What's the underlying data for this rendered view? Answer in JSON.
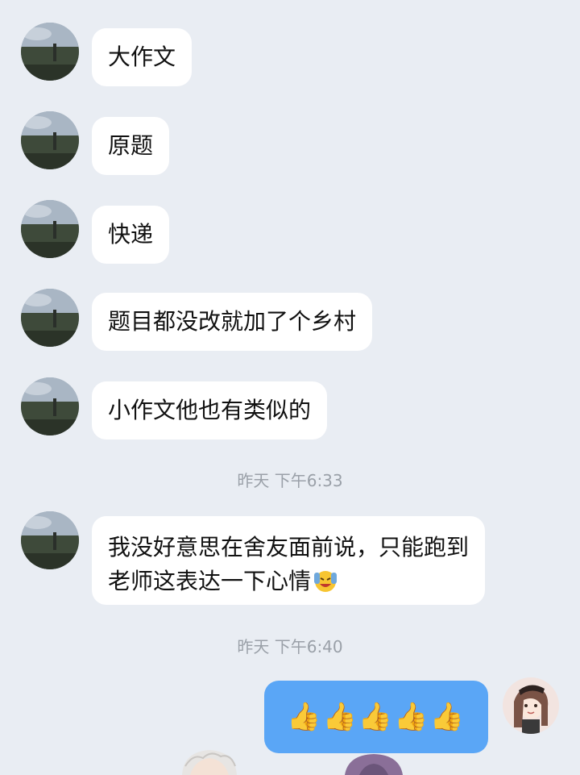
{
  "messages": [
    {
      "text": "大作文"
    },
    {
      "text": "原题"
    },
    {
      "text": "快递"
    },
    {
      "text": "题目都没改就加了个乡村"
    },
    {
      "text": "小作文他也有类似的"
    },
    {
      "text": "我没好意思在舍友面前说，只能跑到老师这表达一下心情"
    }
  ],
  "timestamps": [
    "昨天 下午6:33",
    "昨天 下午6:40"
  ],
  "my_message": {
    "text": "👍👍👍👍👍"
  },
  "emoji_icon": "facepalm-laugh-emoji",
  "colors": {
    "background": "#e9edf3",
    "incoming_bubble": "#ffffff",
    "outgoing_bubble": "#5aa6f6",
    "timestamp": "#9aa0a8"
  }
}
